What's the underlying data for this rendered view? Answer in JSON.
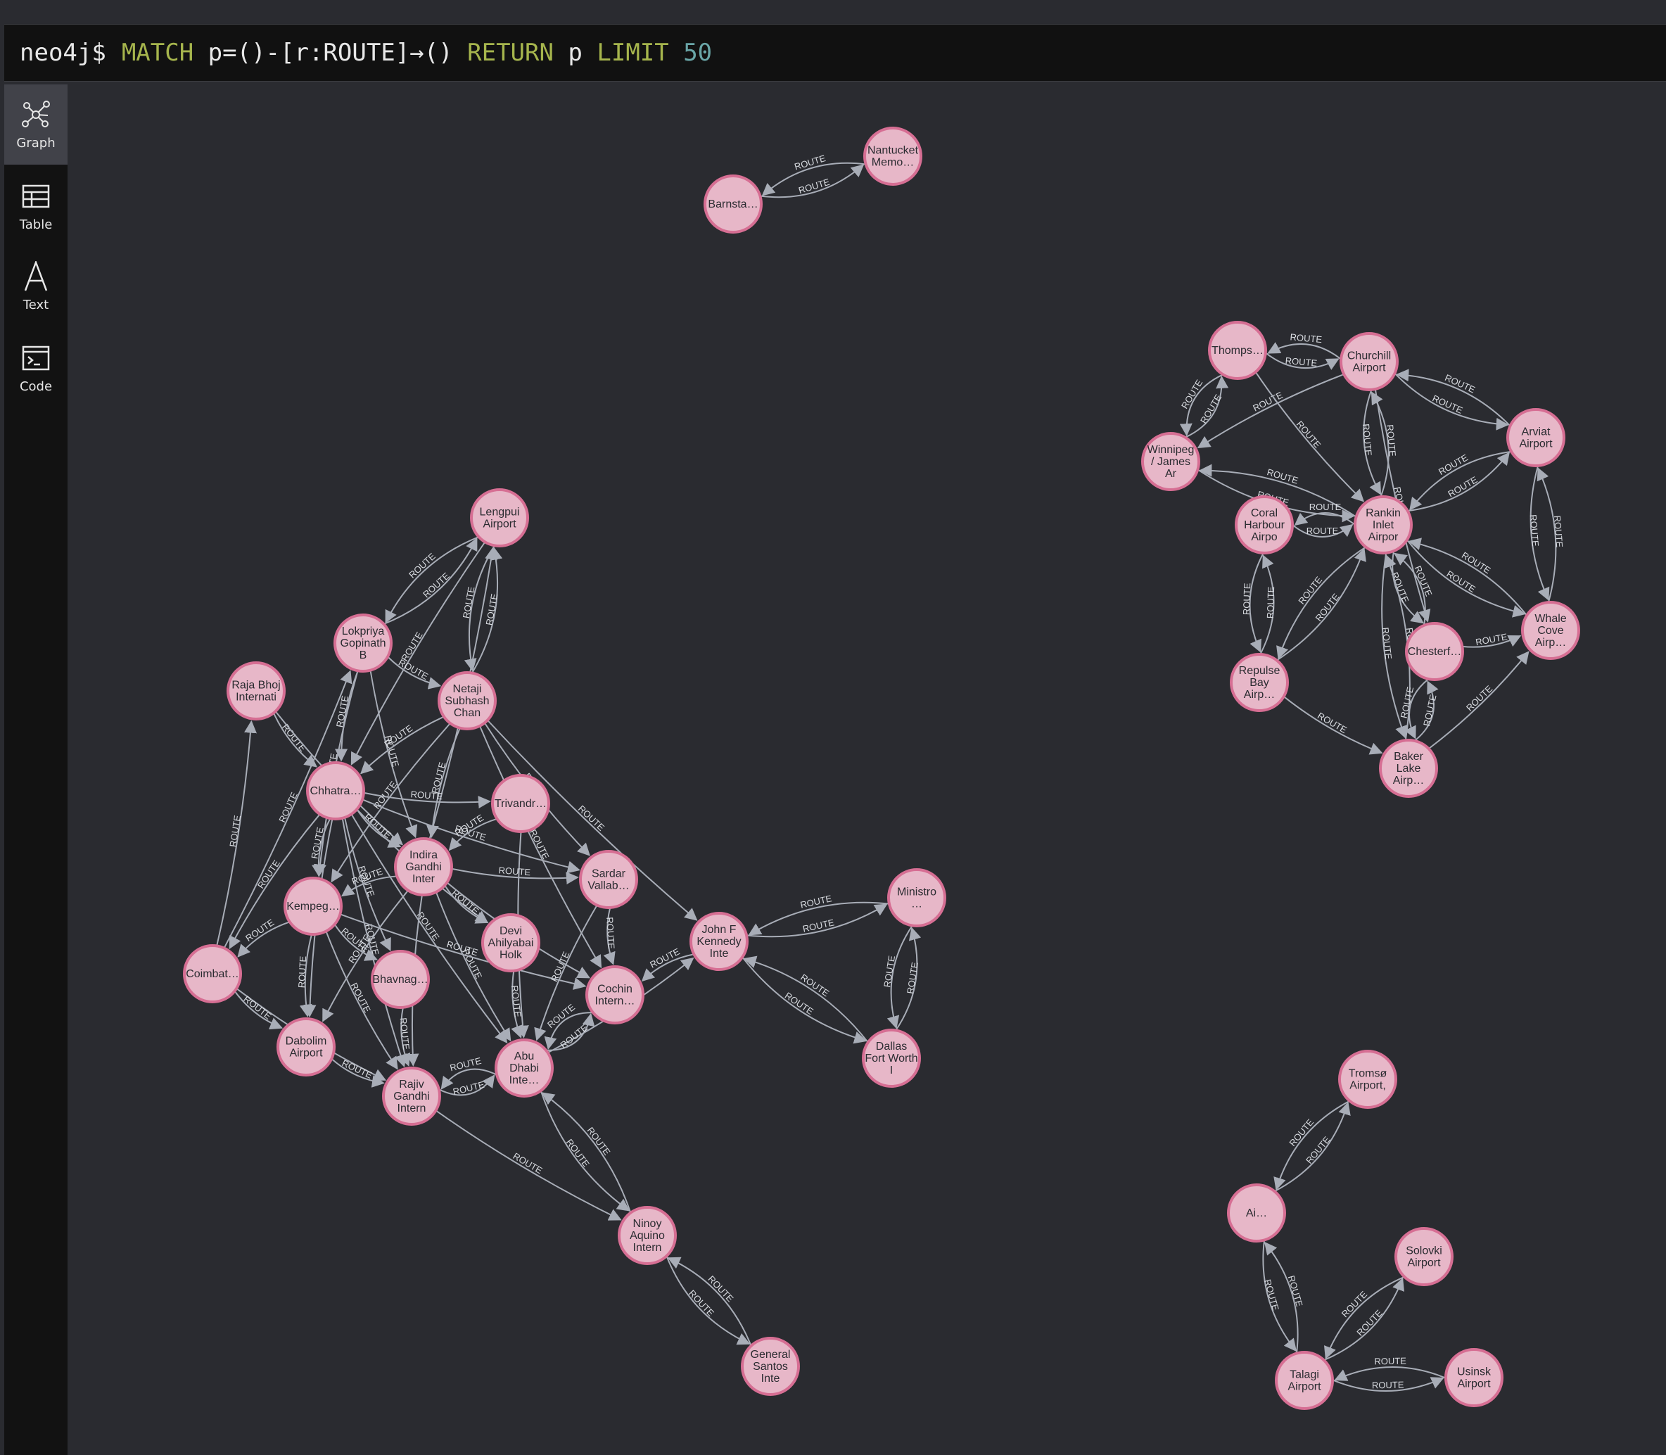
{
  "query": {
    "prompt": "neo4j$",
    "tokens": [
      {
        "text": "MATCH",
        "kind": "kw"
      },
      {
        "text": " p=()-[r:ROUTE]→() ",
        "kind": "plain"
      },
      {
        "text": "RETURN",
        "kind": "kw"
      },
      {
        "text": " p ",
        "kind": "plain"
      },
      {
        "text": "LIMIT",
        "kind": "kw"
      },
      {
        "text": " 50",
        "kind": "num"
      }
    ]
  },
  "sidebar": {
    "items": [
      {
        "label": "Graph",
        "icon": "graph-icon",
        "active": true
      },
      {
        "label": "Table",
        "icon": "table-icon",
        "active": false
      },
      {
        "label": "Text",
        "icon": "text-icon",
        "active": false
      },
      {
        "label": "Code",
        "icon": "code-icon",
        "active": false
      }
    ]
  },
  "graph": {
    "relationship_type": "ROUTE",
    "colors": {
      "node_fill": "#e7b7c8",
      "node_stroke": "#d66e93",
      "edge": "#a8adb7"
    },
    "nodes": [
      {
        "id": "barnstable",
        "lines": [
          "Barnsta…"
        ]
      },
      {
        "id": "nantucket",
        "lines": [
          "Nantucket",
          "Memo…"
        ]
      },
      {
        "id": "thompson",
        "lines": [
          "Thomps…"
        ]
      },
      {
        "id": "churchill",
        "lines": [
          "Churchill",
          "Airport"
        ]
      },
      {
        "id": "winnipeg",
        "lines": [
          "Winnipeg",
          "/ James",
          "Ar"
        ]
      },
      {
        "id": "arviat",
        "lines": [
          "Arviat",
          "Airport"
        ]
      },
      {
        "id": "coral",
        "lines": [
          "Coral",
          "Harbour",
          "Airpo"
        ]
      },
      {
        "id": "rankin",
        "lines": [
          "Rankin",
          "Inlet",
          "Airpor"
        ]
      },
      {
        "id": "whale",
        "lines": [
          "Whale",
          "Cove",
          "Airp…"
        ]
      },
      {
        "id": "chesterfield",
        "lines": [
          "Chesterf…"
        ]
      },
      {
        "id": "repulse",
        "lines": [
          "Repulse",
          "Bay",
          "Airp…"
        ]
      },
      {
        "id": "baker",
        "lines": [
          "Baker",
          "Lake",
          "Airp…"
        ]
      },
      {
        "id": "lengpui",
        "lines": [
          "Lengpui",
          "Airport"
        ]
      },
      {
        "id": "lokpriya",
        "lines": [
          "Lokpriya",
          "Gopinath",
          "B"
        ]
      },
      {
        "id": "rajabhoj",
        "lines": [
          "Raja Bhoj",
          "Internati"
        ]
      },
      {
        "id": "netaji",
        "lines": [
          "Netaji",
          "Subhash",
          "Chan"
        ]
      },
      {
        "id": "chhatrapati",
        "lines": [
          "Chhatra…"
        ]
      },
      {
        "id": "trivandrum",
        "lines": [
          "Trivandr…"
        ]
      },
      {
        "id": "indira",
        "lines": [
          "Indira",
          "Gandhi",
          "Inter"
        ]
      },
      {
        "id": "sardar",
        "lines": [
          "Sardar",
          "Vallab…"
        ]
      },
      {
        "id": "kempegowda",
        "lines": [
          "Kempeg…"
        ]
      },
      {
        "id": "devi",
        "lines": [
          "Devi",
          "Ahilyabai",
          "Holk"
        ]
      },
      {
        "id": "coimbatore",
        "lines": [
          "Coimbat…"
        ]
      },
      {
        "id": "bhavnagar",
        "lines": [
          "Bhavnag…"
        ]
      },
      {
        "id": "cochin",
        "lines": [
          "Cochin",
          "Intern…"
        ]
      },
      {
        "id": "dabolim",
        "lines": [
          "Dabolim",
          "Airport"
        ]
      },
      {
        "id": "abudhabi",
        "lines": [
          "Abu",
          "Dhabi",
          "Inte…"
        ]
      },
      {
        "id": "rajiv",
        "lines": [
          "Rajiv",
          "Gandhi",
          "Intern"
        ]
      },
      {
        "id": "jfk",
        "lines": [
          "John F",
          "Kennedy",
          "Inte"
        ]
      },
      {
        "id": "ministro",
        "lines": [
          "Ministro",
          "…"
        ]
      },
      {
        "id": "dallas",
        "lines": [
          "Dallas",
          "Fort Worth",
          "I"
        ]
      },
      {
        "id": "ninoy",
        "lines": [
          "Ninoy",
          "Aquino",
          "Intern"
        ]
      },
      {
        "id": "gensantos",
        "lines": [
          "General",
          "Santos",
          "Inte"
        ]
      },
      {
        "id": "tromso",
        "lines": [
          "Tromsø",
          "Airport,"
        ]
      },
      {
        "id": "ai",
        "lines": [
          "Ai…"
        ]
      },
      {
        "id": "solovki",
        "lines": [
          "Solovki",
          "Airport"
        ]
      },
      {
        "id": "talagi",
        "lines": [
          "Talagi",
          "Airport"
        ]
      },
      {
        "id": "usinsk",
        "lines": [
          "Usinsk",
          "Airport"
        ]
      }
    ],
    "edges": [
      [
        "barnstable",
        "nantucket"
      ],
      [
        "nantucket",
        "barnstable"
      ],
      [
        "thompson",
        "churchill"
      ],
      [
        "churchill",
        "thompson"
      ],
      [
        "thompson",
        "winnipeg"
      ],
      [
        "winnipeg",
        "thompson"
      ],
      [
        "churchill",
        "winnipeg"
      ],
      [
        "churchill",
        "arviat"
      ],
      [
        "arviat",
        "churchill"
      ],
      [
        "churchill",
        "rankin"
      ],
      [
        "rankin",
        "churchill"
      ],
      [
        "winnipeg",
        "rankin"
      ],
      [
        "rankin",
        "winnipeg"
      ],
      [
        "arviat",
        "rankin"
      ],
      [
        "rankin",
        "arviat"
      ],
      [
        "coral",
        "rankin"
      ],
      [
        "rankin",
        "coral"
      ],
      [
        "rankin",
        "whale"
      ],
      [
        "whale",
        "rankin"
      ],
      [
        "rankin",
        "chesterfield"
      ],
      [
        "chesterfield",
        "rankin"
      ],
      [
        "rankin",
        "repulse"
      ],
      [
        "repulse",
        "rankin"
      ],
      [
        "rankin",
        "baker"
      ],
      [
        "baker",
        "rankin"
      ],
      [
        "arviat",
        "whale"
      ],
      [
        "whale",
        "arviat"
      ],
      [
        "coral",
        "repulse"
      ],
      [
        "repulse",
        "coral"
      ],
      [
        "chesterfield",
        "baker"
      ],
      [
        "baker",
        "chesterfield"
      ],
      [
        "repulse",
        "baker"
      ],
      [
        "baker",
        "whale"
      ],
      [
        "chesterfield",
        "whale"
      ],
      [
        "churchill",
        "chesterfield"
      ],
      [
        "thompson",
        "rankin"
      ],
      [
        "lengpui",
        "lokpriya"
      ],
      [
        "lokpriya",
        "lengpui"
      ],
      [
        "lengpui",
        "netaji"
      ],
      [
        "netaji",
        "lengpui"
      ],
      [
        "lengpui",
        "chhatrapati"
      ],
      [
        "indira",
        "lengpui"
      ],
      [
        "lokpriya",
        "netaji"
      ],
      [
        "lokpriya",
        "chhatrapati"
      ],
      [
        "lokpriya",
        "indira"
      ],
      [
        "lokpriya",
        "kempegowda"
      ],
      [
        "rajabhoj",
        "chhatrapati"
      ],
      [
        "rajabhoj",
        "indira"
      ],
      [
        "netaji",
        "chhatrapati"
      ],
      [
        "netaji",
        "indira"
      ],
      [
        "netaji",
        "sardar"
      ],
      [
        "netaji",
        "kempegowda"
      ],
      [
        "netaji",
        "cochin"
      ],
      [
        "netaji",
        "jfk"
      ],
      [
        "chhatrapati",
        "indira"
      ],
      [
        "chhatrapati",
        "kempegowda"
      ],
      [
        "chhatrapati",
        "coimbatore"
      ],
      [
        "chhatrapati",
        "dabolim"
      ],
      [
        "chhatrapati",
        "rajiv"
      ],
      [
        "chhatrapati",
        "abudhabi"
      ],
      [
        "chhatrapati",
        "trivandrum"
      ],
      [
        "chhatrapati",
        "sardar"
      ],
      [
        "chhatrapati",
        "bhavnagar"
      ],
      [
        "chhatrapati",
        "devi"
      ],
      [
        "trivandrum",
        "abudhabi"
      ],
      [
        "trivandrum",
        "indira"
      ],
      [
        "indira",
        "kempegowda"
      ],
      [
        "indira",
        "sardar"
      ],
      [
        "indira",
        "devi"
      ],
      [
        "indira",
        "cochin"
      ],
      [
        "indira",
        "rajiv"
      ],
      [
        "indira",
        "abudhabi"
      ],
      [
        "indira",
        "dabolim"
      ],
      [
        "kempegowda",
        "coimbatore"
      ],
      [
        "kempegowda",
        "dabolim"
      ],
      [
        "kempegowda",
        "rajiv"
      ],
      [
        "kempegowda",
        "bhavnagar"
      ],
      [
        "kempegowda",
        "cochin"
      ],
      [
        "coimbatore",
        "rajiv"
      ],
      [
        "coimbatore",
        "dabolim"
      ],
      [
        "bhavnagar",
        "rajiv"
      ],
      [
        "dabolim",
        "rajiv"
      ],
      [
        "rajiv",
        "abudhabi"
      ],
      [
        "abudhabi",
        "rajiv"
      ],
      [
        "cochin",
        "abudhabi"
      ],
      [
        "sardar",
        "abudhabi"
      ],
      [
        "sardar",
        "cochin"
      ],
      [
        "devi",
        "abudhabi"
      ],
      [
        "abudhabi",
        "jfk"
      ],
      [
        "jfk",
        "cochin"
      ],
      [
        "abudhabi",
        "ninoy"
      ],
      [
        "ninoy",
        "abudhabi"
      ],
      [
        "rajiv",
        "ninoy"
      ],
      [
        "abudhabi",
        "cochin"
      ],
      [
        "coimbatore",
        "rajabhoj"
      ],
      [
        "coimbatore",
        "lokpriya"
      ],
      [
        "jfk",
        "ministro"
      ],
      [
        "ministro",
        "jfk"
      ],
      [
        "jfk",
        "dallas"
      ],
      [
        "dallas",
        "jfk"
      ],
      [
        "ministro",
        "dallas"
      ],
      [
        "dallas",
        "ministro"
      ],
      [
        "ninoy",
        "gensantos"
      ],
      [
        "gensantos",
        "ninoy"
      ],
      [
        "tromso",
        "ai"
      ],
      [
        "ai",
        "tromso"
      ],
      [
        "ai",
        "talagi"
      ],
      [
        "talagi",
        "ai"
      ],
      [
        "solovki",
        "talagi"
      ],
      [
        "talagi",
        "solovki"
      ],
      [
        "talagi",
        "usinsk"
      ],
      [
        "usinsk",
        "talagi"
      ]
    ]
  }
}
